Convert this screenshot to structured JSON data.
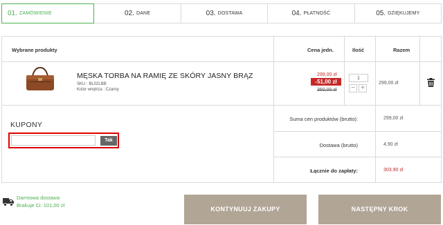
{
  "steps": [
    {
      "num": "01.",
      "label": "ZAMÓWIENIE"
    },
    {
      "num": "02.",
      "label": "DANE"
    },
    {
      "num": "03.",
      "label": "DOSTAWA"
    },
    {
      "num": "04.",
      "label": "PŁATNOŚĆ"
    },
    {
      "num": "05.",
      "label": "DZIĘKUJEMY"
    }
  ],
  "cart": {
    "headers": {
      "products": "Wybrane produkty",
      "unit_price": "Cena jedn.",
      "qty": "Ilość",
      "total": "Razem"
    },
    "item": {
      "name": "MĘSKA TORBA NA RAMIĘ ZE SKÓRY JASNY BRĄZ",
      "sku": "SKU : BL02LBB",
      "color": "Kolor wnętrza : Czarny",
      "price": "299,00 zł",
      "discount": "-51,00 zł",
      "old_price": "350,00 zł",
      "quantity": "1",
      "minus": "−",
      "plus": "+",
      "row_total": "299,00 zł",
      "icon": "trash-icon"
    },
    "coupons": {
      "title": "KUPONY",
      "placeholder": "",
      "apply": "Tak"
    },
    "summary": {
      "products_label": "Suma cen produktów (brutto):",
      "products_value": "299,00 zł",
      "shipping_label": "Dostawa (brutto)",
      "shipping_value": "4,90 zł",
      "total_label": "Łącznie do zapłaty:",
      "total_value": "303,90 zł"
    }
  },
  "footer": {
    "free_shipping": "Darmowa dostawa",
    "missing": "Brakuje Ci: 101,00 zł",
    "continue": "KONTYNUUJ ZAKUPY",
    "next": "NASTĘPNY KROK"
  },
  "colors": {
    "accent": "#4caf50",
    "red": "#c62828",
    "button": "#b1a595"
  }
}
